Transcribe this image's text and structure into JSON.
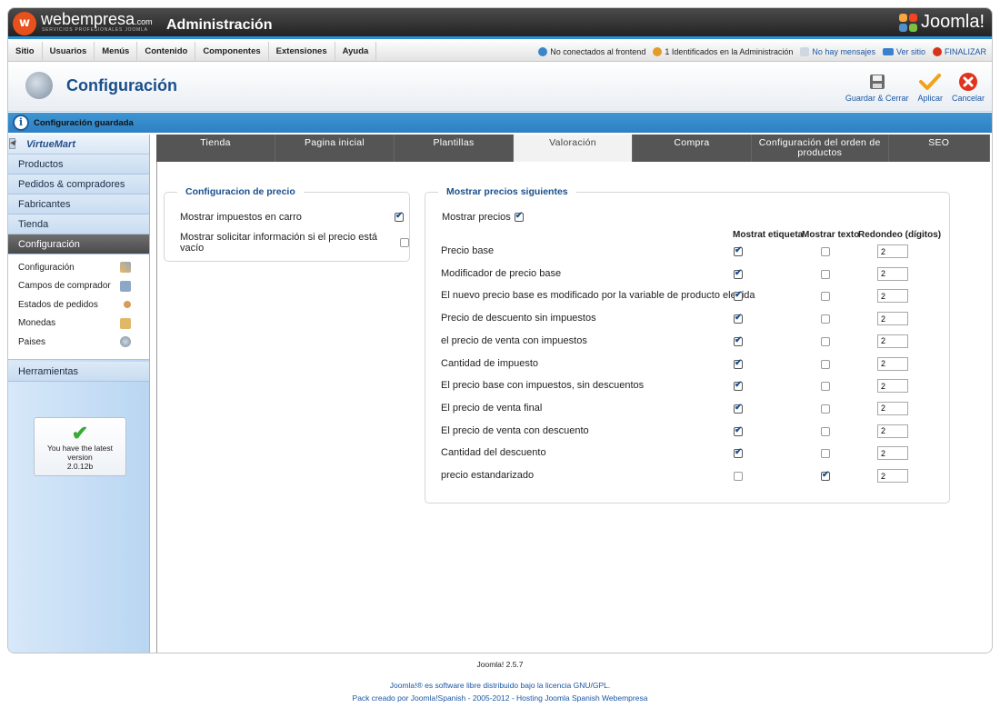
{
  "header": {
    "brand": "webempresa",
    "brand_suffix": ".com",
    "brand_sub": "SERVICIOS PROFESIONALES JOOMLA",
    "title": "Administración",
    "joomla_logo": "Joomla!"
  },
  "menu": {
    "items": [
      "Sitio",
      "Usuarios",
      "Menús",
      "Contenido",
      "Componentes",
      "Extensiones",
      "Ayuda"
    ]
  },
  "status": {
    "frontend": "No conectados al frontend",
    "admin": "1 Identificados en la Administración",
    "messages": "No hay mensajes",
    "view_site": "Ver sitio",
    "logout": "FINALIZAR"
  },
  "toolbar": {
    "title": "Configuración",
    "save_close": "Guardar & Cerrar",
    "apply": "Aplicar",
    "cancel": "Cancelar"
  },
  "message": {
    "text": "Configuración guardada"
  },
  "sidebar": {
    "logo": "VirtueMart",
    "heads": [
      "Productos",
      "Pedidos & compradores",
      "Fabricantes",
      "Tienda"
    ],
    "active_head": "Configuración",
    "sub_items": [
      "Configuración",
      "Campos de comprador",
      "Estados de pedidos",
      "Monedas",
      "Paises"
    ],
    "tools": "Herramientas",
    "version_line1": "You have the latest",
    "version_line2": "version",
    "version_number": "2.0.12b"
  },
  "tabs": [
    "Tienda",
    "Pagina inicial",
    "Plantillas",
    "Valoración",
    "Compra",
    "Configuración del orden de productos",
    "SEO"
  ],
  "price_config": {
    "legend": "Configuracion de precio",
    "row1": "Mostrar impuestos en carro",
    "row1_checked": true,
    "row2": "Mostrar solicitar información si el precio está vacío",
    "row2_checked": false
  },
  "show_prices": {
    "legend": "Mostrar precios siguientes",
    "show_label": "Mostrar precios",
    "show_checked": true,
    "col_label": "Mostrat etiqueta",
    "col_text": "Mostrar texto",
    "col_round": "Redondeo (dígitos)",
    "rows": [
      {
        "label": "Precio base",
        "etiqueta": true,
        "texto": false,
        "round": "2"
      },
      {
        "label": "Modificador de precio base",
        "etiqueta": true,
        "texto": false,
        "round": "2"
      },
      {
        "label": "El nuevo precio base es modificado por la variable de producto elegida",
        "etiqueta": true,
        "texto": false,
        "round": "2"
      },
      {
        "label": "Precio de descuento sin impuestos",
        "etiqueta": true,
        "texto": false,
        "round": "2"
      },
      {
        "label": "el precio de venta con impuestos",
        "etiqueta": true,
        "texto": false,
        "round": "2"
      },
      {
        "label": "Cantidad de impuesto",
        "etiqueta": true,
        "texto": false,
        "round": "2"
      },
      {
        "label": "El precio base con impuestos, sin descuentos",
        "etiqueta": true,
        "texto": false,
        "round": "2"
      },
      {
        "label": "El precio de venta final",
        "etiqueta": true,
        "texto": false,
        "round": "2"
      },
      {
        "label": "El precio de venta con descuento",
        "etiqueta": true,
        "texto": false,
        "round": "2"
      },
      {
        "label": "Cantidad del descuento",
        "etiqueta": true,
        "texto": false,
        "round": "2"
      },
      {
        "label": "precio estandarizado",
        "etiqueta": false,
        "texto": true,
        "round": "2"
      }
    ]
  },
  "footer": {
    "version": "Joomla! 2.5.7",
    "line1": "Joomla!® es software libre distribuido bajo la licencia GNU/GPL.",
    "line2": "Pack creado por Joomla!Spanish - 2005-2012 - Hosting Joomla Spanish Webempresa"
  },
  "colors": {
    "accent": "#2a8fd1",
    "title_blue": "#1a4f8c",
    "brand_orange": "#e8501c"
  }
}
